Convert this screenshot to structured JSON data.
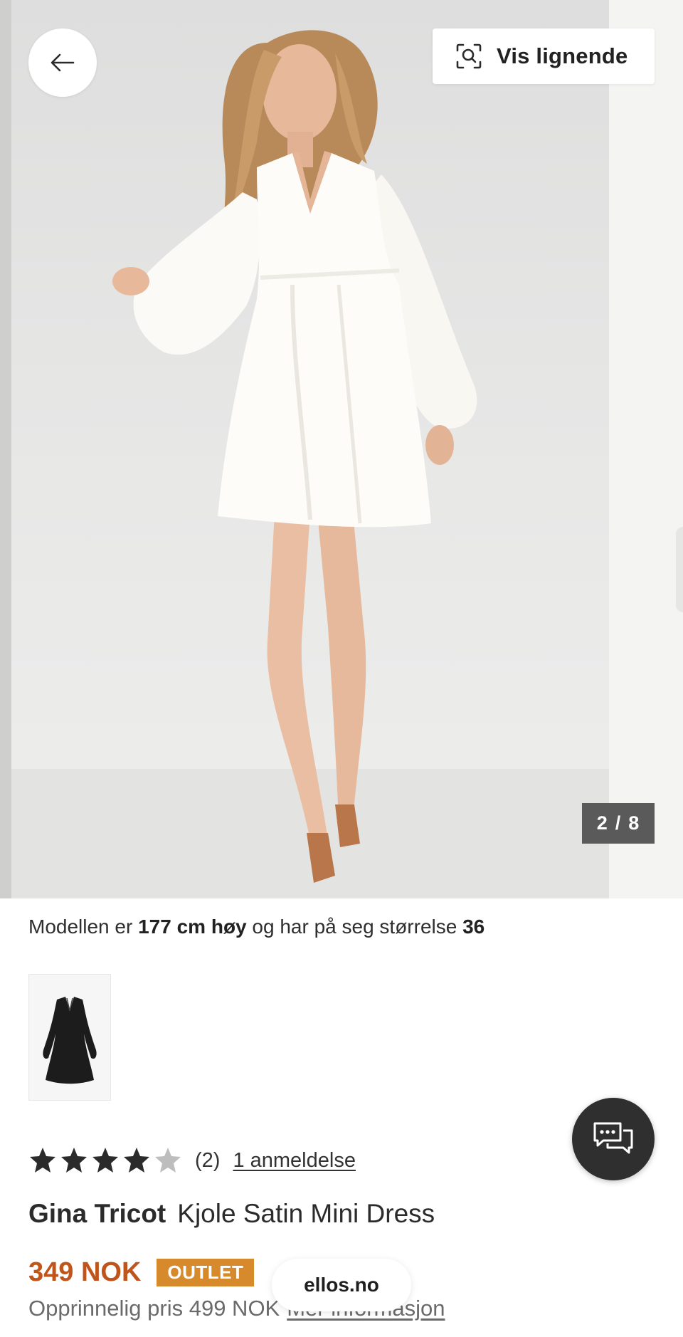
{
  "hero": {
    "similar_label": "Vis lignende",
    "counter": {
      "current": "2",
      "separator": "/",
      "total": "8"
    }
  },
  "model_info": {
    "prefix": "Modellen er",
    "height": "177 cm høy",
    "middle": "og har på seg størrelse",
    "size": "36"
  },
  "rating": {
    "value": 4,
    "max": 5,
    "count": "(2)",
    "reviews_link": "1 anmeldelse"
  },
  "product": {
    "brand": "Gina Tricot",
    "name": "Kjole Satin Mini Dress",
    "price": "349 NOK",
    "badge": "OUTLET",
    "original_price": "Opprinnelig pris 499 NOK",
    "more_info": "Mer informasjon"
  },
  "browser": {
    "url": "ellos.no"
  },
  "colors": {
    "price": "#c0551c",
    "badge": "#d78a2c",
    "star_filled": "#2b2b2b",
    "star_empty": "#bdbdbd",
    "chat_bg": "#2f2f2f",
    "counter_bg": "#5a5a5a"
  },
  "icons": {
    "back": "arrow-left-icon",
    "similar": "visual-search-icon",
    "chat": "chat-bubbles-icon",
    "star": "star-icon"
  }
}
